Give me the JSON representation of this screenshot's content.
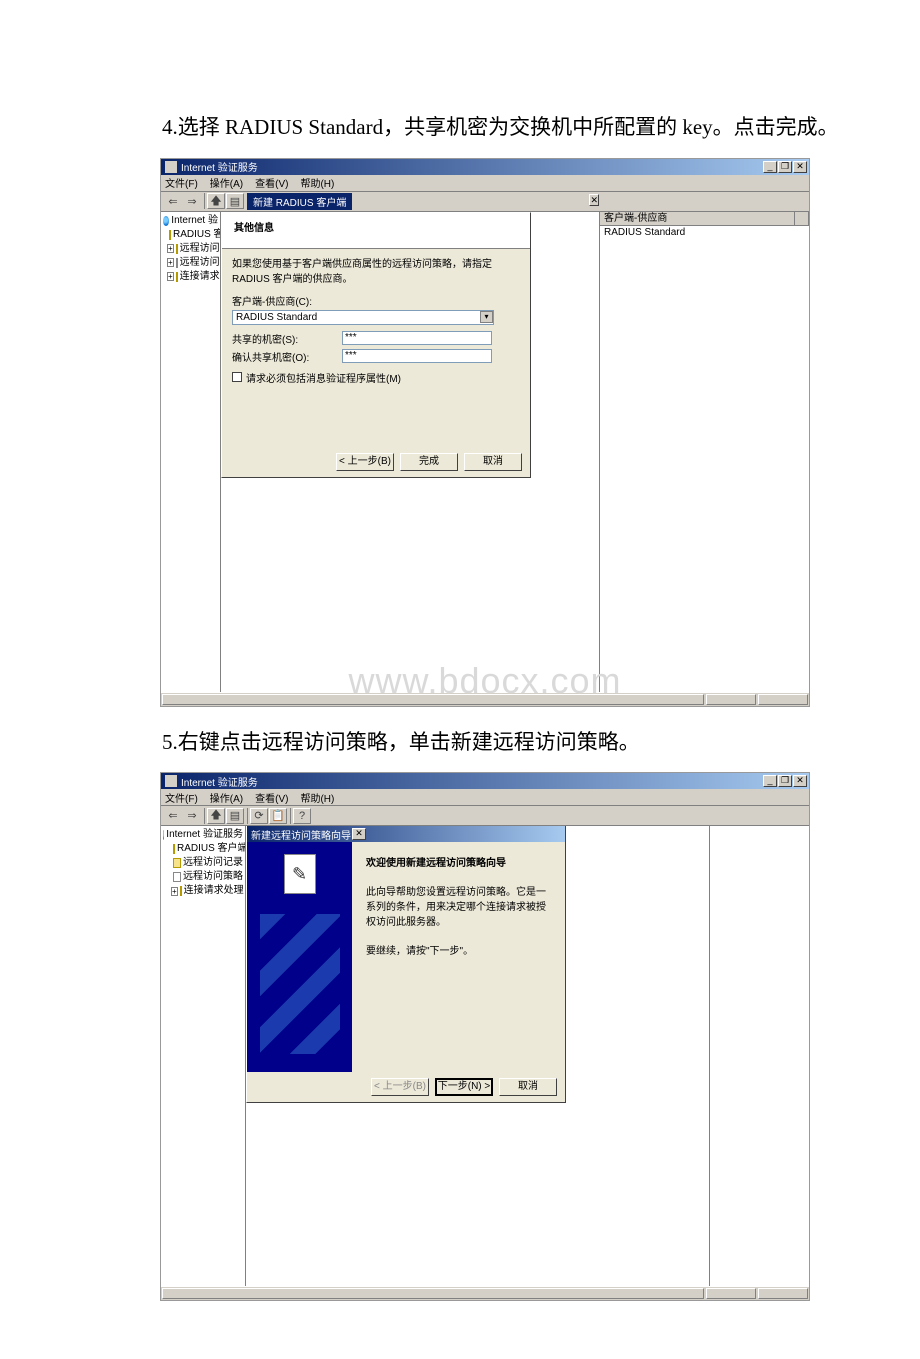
{
  "step4": "4.选择 RADIUS Standard，共享机密为交换机中所配置的 key。点击完成。",
  "step5": "5.右键点击远程访问策略，单击新建远程访问策略。",
  "app_title": "Internet 验证服务",
  "menu": {
    "file": "文件(F)",
    "action": "操作(A)",
    "view": "查看(V)",
    "help": "帮助(H)"
  },
  "toolbar_nav": {
    "back": "⇐",
    "fwd": "⇒",
    "up": "🡅",
    "list": "▤",
    "refresh": "⟳",
    "exp": "📋",
    "help": "?"
  },
  "tree1": {
    "root": "Internet 验",
    "n1": "RADIUS 客",
    "n2": "远程访问",
    "n3": "远程访问",
    "n4": "连接请求"
  },
  "tree2": {
    "root2": "Internet 验证服务",
    "c1": "RADIUS 客户端",
    "c2": "远程访问记录",
    "c3": "远程访问策略",
    "c4": "连接请求处理"
  },
  "wizard1": {
    "title": "新建 RADIUS 客户端",
    "heading": "其他信息",
    "desc": "如果您使用基于客户端供应商属性的远程访问策略，请指定 RADIUS 客户端的供应商。",
    "vendor_label": "客户端-供应商(C):",
    "vendor_value": "RADIUS Standard",
    "secret_label": "共享的机密(S):",
    "secret_value": "***",
    "confirm_label": "确认共享机密(O):",
    "confirm_value": "***",
    "chk": "请求必须包括消息验证程序属性(M)",
    "back": "< 上一步(B)",
    "finish": "完成",
    "cancel": "取消"
  },
  "list1": {
    "col": "客户端-供应商",
    "row": "RADIUS Standard"
  },
  "wizard2": {
    "title": "新建远程访问策略向导",
    "welcome": "欢迎使用新建远程访问策略向导",
    "desc": "此向导帮助您设置远程访问策略。它是一系列的条件，用来决定哪个连接请求被授权访问此服务器。",
    "cont": "要继续，请按\"下一步\"。",
    "back2": "< 上一步(B)",
    "next": "下一步(N) >",
    "cancel2": "取消"
  },
  "watermark": "www.bdocx.com",
  "winbtns": {
    "min": "_",
    "max": "❐",
    "close": "✕",
    "dlgclose": "✕"
  }
}
